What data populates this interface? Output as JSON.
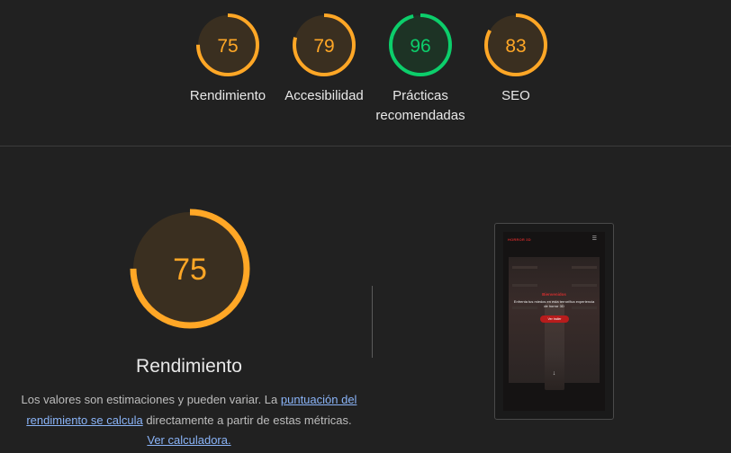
{
  "categories": [
    {
      "score": "75",
      "value": 75,
      "label": "Rendimiento",
      "color": "#ffa726",
      "fill": "#3a2f20"
    },
    {
      "score": "79",
      "value": 79,
      "label": "Accesibilidad",
      "color": "#ffa726",
      "fill": "#3a2f20"
    },
    {
      "score": "96",
      "value": 96,
      "label_line1": "Prácticas",
      "label_line2": "recomendadas",
      "color": "#0cce6b",
      "fill": "#1d3325"
    },
    {
      "score": "83",
      "value": 83,
      "label": "SEO",
      "color": "#ffa726",
      "fill": "#3a2f20"
    }
  ],
  "performance": {
    "score": "75",
    "value": 75,
    "title": "Rendimiento",
    "color": "#ffa726",
    "desc_prefix": "Los valores son estimaciones y pueden variar. La ",
    "link1": "puntuación del rendimiento se calcula",
    "desc_mid": " directamente a partir de estas métricas. ",
    "link2": "Ver calculadora."
  },
  "screenshot": {
    "logo": "HORROR 3D",
    "menu_icon": "menu-icon",
    "hero_title": "Bienvenidos",
    "hero_text": "Enfrenta tus miedos en esta terrorífica experiencia de horror 3D",
    "cta": "Ver trailer",
    "arrow": "↓"
  }
}
